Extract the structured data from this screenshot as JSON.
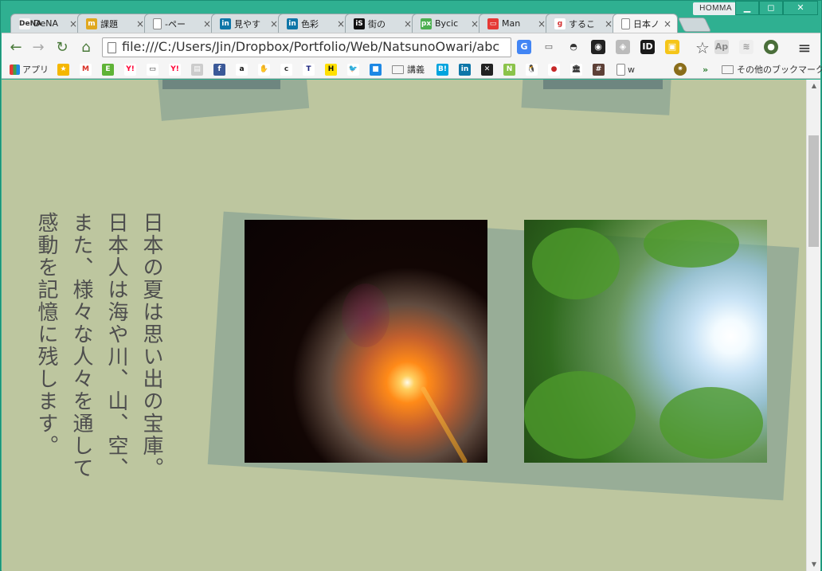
{
  "window": {
    "user_badge": "HOMMA",
    "controls": {
      "minimize": "▁",
      "maximize": "◻",
      "close": "✕"
    }
  },
  "tabs": [
    {
      "label": "DeNA",
      "favicon_color": "#f5f5f5",
      "favicon_text": "DeNA",
      "favicon_text_color": "#333333"
    },
    {
      "label": "課題",
      "favicon_color": "#e0a81e",
      "favicon_text": "m"
    },
    {
      "label": "-ペー",
      "favicon_color": "#ffffff",
      "favicon_text": "",
      "favicon_text_color": "#777777"
    },
    {
      "label": "見やす",
      "favicon_color": "#0e76a8",
      "favicon_text": "in"
    },
    {
      "label": "色彩",
      "favicon_color": "#0e76a8",
      "favicon_text": "in"
    },
    {
      "label": "街の",
      "favicon_color": "#111111",
      "favicon_text": "iS"
    },
    {
      "label": "Bycic",
      "favicon_color": "#4caf50",
      "favicon_text": "px"
    },
    {
      "label": "Man",
      "favicon_color": "#e53935",
      "favicon_text": "▭"
    },
    {
      "label": "するこ",
      "favicon_color": "#ffffff",
      "favicon_text": "g",
      "favicon_text_color": "#d32f2f"
    },
    {
      "label": "日本ノ",
      "favicon_color": "#ffffff",
      "favicon_text": "",
      "active": true
    }
  ],
  "toolbar": {
    "back": "←",
    "forward": "→",
    "reload": "↻",
    "home": "⌂",
    "url": "file:///C:/Users/Jin/Dropbox/Portfolio/Web/NatsunoOwari/abc",
    "bookmark_star": "☆",
    "menu": "≡",
    "extensions": [
      {
        "name": "translate-extension",
        "color": "#4285f4",
        "text": "G"
      },
      {
        "name": "cast-extension",
        "color": "#f5f5f5",
        "text": "▭",
        "text_color": "#555555"
      },
      {
        "name": "incognito-extension",
        "color": "#f5f5f5",
        "text": "◓",
        "text_color": "#333333"
      },
      {
        "name": "color-picker-extension",
        "color": "#222222",
        "text": "◉"
      },
      {
        "name": "shield-extension",
        "color": "#bbbbbb",
        "text": "◈"
      },
      {
        "name": "id-extension",
        "color": "#1a1a1a",
        "text": "ID"
      },
      {
        "name": "folder-extension",
        "color": "#f5c518",
        "text": "▣"
      },
      {
        "name": "ap-extension",
        "color": "#dddddd",
        "text": "Ap",
        "text_color": "#888888"
      },
      {
        "name": "wave-extension",
        "color": "#eeeeee",
        "text": "≋",
        "text_color": "#999999"
      },
      {
        "name": "avatar-extension",
        "color": "#4a6e3a",
        "text": "●"
      }
    ]
  },
  "bookmarks": {
    "apps_label": "アプリ",
    "items": [
      {
        "name": "bookmark-star",
        "color": "#f5b700",
        "text": "★"
      },
      {
        "name": "bookmark-gmail",
        "color": "#ffffff",
        "text": "M",
        "text_color": "#d93025"
      },
      {
        "name": "bookmark-evernote",
        "color": "#5fb336",
        "text": "E"
      },
      {
        "name": "bookmark-yahoo",
        "color": "#ffffff",
        "text": "Y!",
        "text_color": "#ff0033"
      },
      {
        "name": "bookmark-tv",
        "color": "#ffffff",
        "text": "▭",
        "text_color": "#333333"
      },
      {
        "name": "bookmark-yahoo-2",
        "color": "#ffffff",
        "text": "Y!",
        "text_color": "#ff0033"
      },
      {
        "name": "bookmark-stack",
        "color": "#cccccc",
        "text": "▤"
      },
      {
        "name": "bookmark-facebook",
        "color": "#3b5998",
        "text": "f"
      },
      {
        "name": "bookmark-amazon",
        "color": "#ffffff",
        "text": "a",
        "text_color": "#111111"
      },
      {
        "name": "bookmark-hand",
        "color": "#ffffff",
        "text": "✋",
        "text_color": "#d32f2f"
      },
      {
        "name": "bookmark-c",
        "color": "#ffffff",
        "text": "c",
        "text_color": "#333333"
      },
      {
        "name": "bookmark-t",
        "color": "#ffffff",
        "text": "T",
        "text_color": "#1a237e"
      },
      {
        "name": "bookmark-h",
        "color": "#ffe000",
        "text": "H",
        "text_color": "#111111"
      },
      {
        "name": "bookmark-twitter",
        "color": "#ffffff",
        "text": "🐦",
        "text_color": "#1da1f2"
      },
      {
        "name": "bookmark-blue-square",
        "color": "#1e88e5",
        "text": "■"
      }
    ],
    "folder_1": "講義",
    "items_2": [
      {
        "name": "bookmark-hatena",
        "color": "#00a4de",
        "text": "B!"
      },
      {
        "name": "bookmark-linkedin",
        "color": "#0e76a8",
        "text": "in"
      },
      {
        "name": "bookmark-xd",
        "color": "#222222",
        "text": "✕"
      },
      {
        "name": "bookmark-n",
        "color": "#8bc34a",
        "text": "N"
      },
      {
        "name": "bookmark-bird",
        "color": "#ffffff",
        "text": "🐧",
        "text_color": "#333333"
      },
      {
        "name": "bookmark-pot",
        "color": "#ffffff",
        "text": "●",
        "text_color": "#c62828"
      },
      {
        "name": "bookmark-museum",
        "color": "#ffffff",
        "text": "🏛",
        "text_color": "#333333"
      },
      {
        "name": "bookmark-hash",
        "color": "#5d4037",
        "text": "#"
      }
    ],
    "doc_label": "w",
    "more": "»",
    "other_folder": "その他のブックマーク"
  },
  "page": {
    "vertical_text": "日本の夏は思い出の宝庫。日本人は海や川、山、空、また、様々な人々を通して感動を記憶に残します。"
  },
  "scrollbar": {
    "up": "▲",
    "down": "▼"
  }
}
